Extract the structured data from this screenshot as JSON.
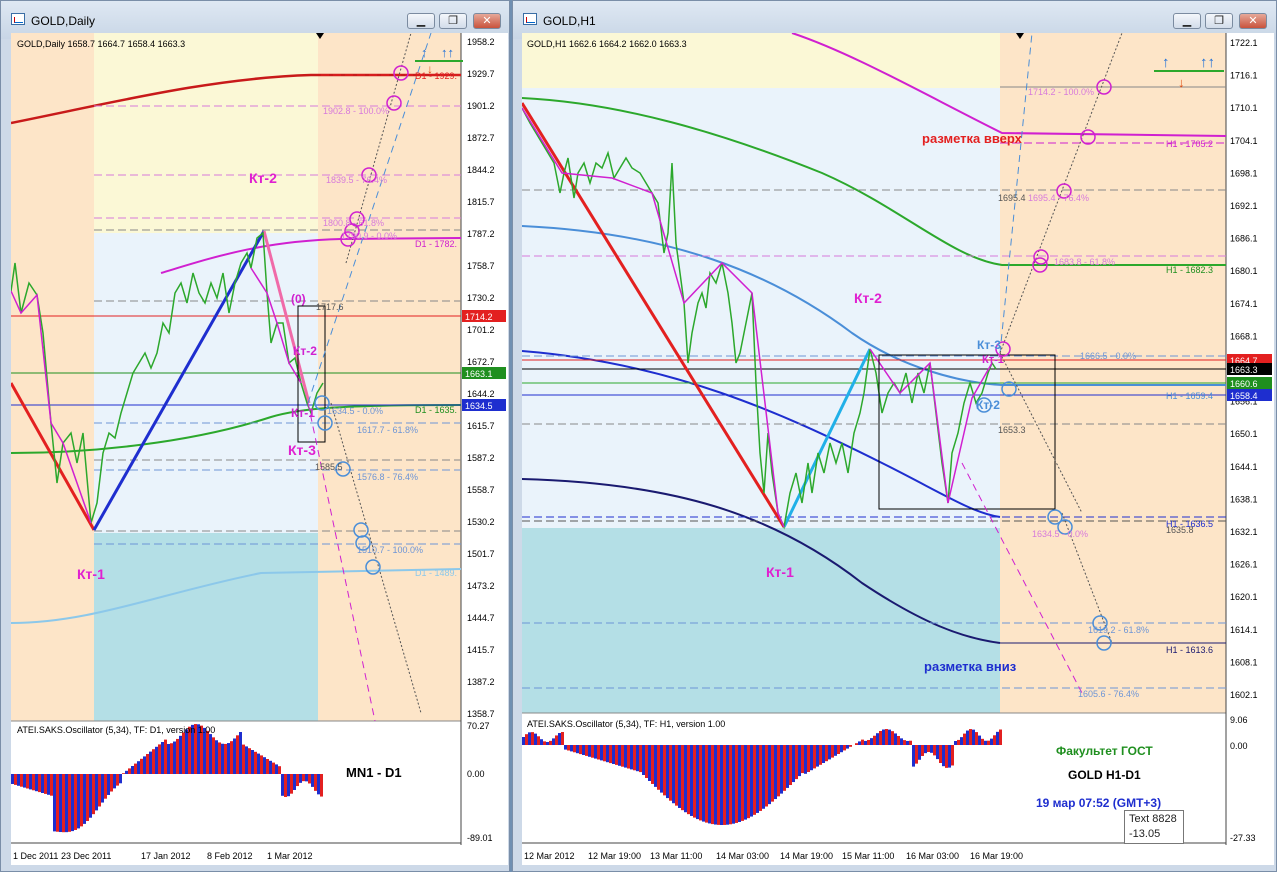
{
  "left_window": {
    "title": "GOLD,Daily",
    "header": "GOLD,Daily  1658.7 1664.7 1658.4 1663.3",
    "price_ticks": [
      "1958.2",
      "1929.7",
      "1901.2",
      "1872.7",
      "1844.2",
      "1815.7",
      "1787.2",
      "1758.7",
      "1730.2",
      "1701.2",
      "1672.7",
      "1644.2",
      "1615.7",
      "1587.2",
      "1558.7",
      "1530.2",
      "1501.7",
      "1473.2",
      "1444.7",
      "1415.7",
      "1387.2",
      "1358.7"
    ],
    "price_badges": [
      {
        "text": "1714.2",
        "color": "#e32020"
      },
      {
        "text": "1663.1",
        "color": "#1f8f1f"
      },
      {
        "text": "1634.5",
        "color": "#1e2ecf"
      }
    ],
    "chart_labels": {
      "kt1": "Кт-1",
      "kt2": "Кт-2",
      "kt3": "Кт-3",
      "kt2b": "Кт-2",
      "kt1b": "Кт-1",
      "zero": "(0)"
    },
    "level_labels": [
      {
        "text": "D1 - 1929.",
        "color": "#e32020"
      },
      {
        "text": "1902.8 - 100.0%",
        "color": "#d77adb"
      },
      {
        "text": "1839.5 - 76.4%",
        "color": "#d77adb"
      },
      {
        "text": "1800.8 - 61.8%",
        "color": "#d77adb"
      },
      {
        "text": "1790.9 - 0.0%",
        "color": "#d77adb"
      },
      {
        "text": "D1 - 1782.",
        "color": "#d020d0"
      },
      {
        "text": "1717.6",
        "color": "#555555"
      },
      {
        "text": "1634.5 - 0.0%",
        "color": "#6d95d6"
      },
      {
        "text": "D1 - 1635.",
        "color": "#1f8f1f"
      },
      {
        "text": "1617.7 - 61.8%",
        "color": "#6d95d6"
      },
      {
        "text": "1585.5",
        "color": "#555555"
      },
      {
        "text": "1576.8 - 76.4%",
        "color": "#6d95d6"
      },
      {
        "text": "1510.7 - 100.0%",
        "color": "#6d95d6"
      },
      {
        "text": "D1 - 1489.",
        "color": "#8cc8ea"
      }
    ],
    "osc_title": "ATEI.SAKS.Oscillator (5,34), TF: D1, version 1.00",
    "osc_ticks": [
      "70.27",
      "0.00",
      "-89.01"
    ],
    "osc_note": "MN1 - D1",
    "time_labels": [
      "1 Dec 2011",
      "23 Dec 2011",
      "17 Jan 2012",
      "8 Feb 2012",
      "1 Mar 2012"
    ]
  },
  "right_window": {
    "title": "GOLD,H1",
    "header": "GOLD,H1  1662.6 1664.2 1662.0 1663.3",
    "price_ticks": [
      "1722.1",
      "1716.1",
      "1710.1",
      "1704.1",
      "1698.1",
      "1692.1",
      "1686.1",
      "1680.1",
      "1674.1",
      "1668.1",
      "1662.1",
      "1656.1",
      "1650.1",
      "1644.1",
      "1638.1",
      "1632.1",
      "1626.1",
      "1620.1",
      "1614.1",
      "1608.1",
      "1602.1"
    ],
    "price_badges": [
      {
        "text": "1664.7",
        "color": "#e32020"
      },
      {
        "text": "1663.3",
        "color": "#000000"
      },
      {
        "text": "1660.6",
        "color": "#1f8f1f"
      },
      {
        "text": "1658.4",
        "color": "#1e2ecf"
      }
    ],
    "chart_labels": {
      "kt1": "Кт-1",
      "kt2": "Кт-2",
      "kt3": "Кт-3",
      "kt1b": "Кт-1",
      "kt2b": "Кт-2"
    },
    "markup_up": "разметка вверх",
    "markup_down": "разметка вниз",
    "level_labels": [
      {
        "text": "1714.2 - 100.0%",
        "color": "#d77adb"
      },
      {
        "text": "H1 - 1705.2",
        "color": "#d020d0"
      },
      {
        "text": "1695.4",
        "color": "#555555"
      },
      {
        "text": "1695.4 - 76.4%",
        "color": "#d77adb"
      },
      {
        "text": "1683.8 - 61.8%",
        "color": "#d77adb"
      },
      {
        "text": "H1 - 1682.3",
        "color": "#1f8f1f"
      },
      {
        "text": "1666.5 - 0.0%",
        "color": "#6d95d6"
      },
      {
        "text": "H1 - 1659.4",
        "color": "#4a8ed8"
      },
      {
        "text": "1653.3",
        "color": "#555555"
      },
      {
        "text": "H1 - 1636.5",
        "color": "#1e2ecf"
      },
      {
        "text": "1635.8",
        "color": "#555555"
      },
      {
        "text": "1634.5 - 0.0%",
        "color": "#d77adb"
      },
      {
        "text": "1619.2 - 61.8%",
        "color": "#6d95d6"
      },
      {
        "text": "H1 - 1613.6",
        "color": "#1a1a70"
      },
      {
        "text": "1605.6 - 76.4%",
        "color": "#6d95d6"
      }
    ],
    "osc_title": "ATEI.SAKS.Oscillator (5,34), TF: H1, version 1.00",
    "osc_ticks": [
      "9.06",
      "0.00",
      "-27.33"
    ],
    "info": {
      "faculty": "Факультет ГОСТ",
      "pair": "GOLD   H1-D1",
      "date": "19 мар 07:52 (GMT+3)"
    },
    "tooltip": {
      "line1": "Text 8828",
      "line2": "-13.05"
    },
    "time_labels": [
      "12 Mar 2012",
      "12 Mar 19:00",
      "13 Mar 11:00",
      "14 Mar 03:00",
      "14 Mar 19:00",
      "15 Mar 11:00",
      "16 Mar 03:00",
      "16 Mar 19:00"
    ]
  },
  "window_buttons": {
    "minimize": "▁",
    "restore": "❐",
    "close": "✕"
  }
}
